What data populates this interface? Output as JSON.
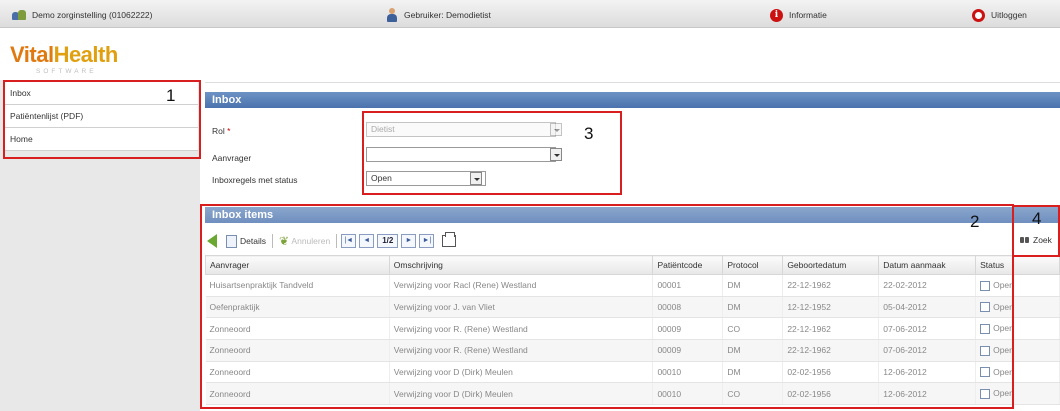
{
  "topbar": {
    "organization": "Demo zorginstelling (01062222)",
    "user": "Gebruiker: Demodietist",
    "info": "Informatie",
    "logout": "Uitloggen"
  },
  "logo": {
    "vital": "Vital",
    "health": "Health",
    "sub": "SOFTWARE"
  },
  "sidebar": {
    "items": [
      {
        "label": "Inbox"
      },
      {
        "label": "Patiëntenlijst (PDF)"
      },
      {
        "label": "Home"
      }
    ]
  },
  "inbox": {
    "title": "Inbox",
    "rol_label": "Rol",
    "rol_required": "*",
    "rol_value": "Dietist",
    "aanvrager_label": "Aanvrager",
    "aanvrager_value": "",
    "status_label": "Inboxregels met status",
    "status_value": "Open"
  },
  "items": {
    "title": "Inbox items",
    "toolbar": {
      "details": "Details",
      "annuleren": "Annuleren",
      "first": "|◄",
      "prev": "◄",
      "page": "1/2",
      "next": "►",
      "last": "►|"
    },
    "zoek": "Zoek",
    "columns": [
      "Aanvrager",
      "Omschrijving",
      "Patiëntcode",
      "Protocol",
      "Geboortedatum",
      "Datum aanmaak",
      "Status"
    ],
    "rows": [
      {
        "aanvrager": "Huisartsenpraktijk Tandveld",
        "omschrijving": "Verwijzing voor Racl (Rene) Westland",
        "code": "00001",
        "protocol": "DM",
        "geboortedatum": "22-12-1962",
        "aanmaak": "22-02-2012",
        "status": "Open"
      },
      {
        "aanvrager": "Oefenpraktijk",
        "omschrijving": "Verwijzing voor J. van Vliet",
        "code": "00008",
        "protocol": "DM",
        "geboortedatum": "12-12-1952",
        "aanmaak": "05-04-2012",
        "status": "Open"
      },
      {
        "aanvrager": "Zonneoord",
        "omschrijving": "Verwijzing voor R. (Rene) Westland",
        "code": "00009",
        "protocol": "CO",
        "geboortedatum": "22-12-1962",
        "aanmaak": "07-06-2012",
        "status": "Open"
      },
      {
        "aanvrager": "Zonneoord",
        "omschrijving": "Verwijzing voor R. (Rene) Westland",
        "code": "00009",
        "protocol": "DM",
        "geboortedatum": "22-12-1962",
        "aanmaak": "07-06-2012",
        "status": "Open"
      },
      {
        "aanvrager": "Zonneoord",
        "omschrijving": "Verwijzing voor D (Dirk) Meulen",
        "code": "00010",
        "protocol": "DM",
        "geboortedatum": "02-02-1956",
        "aanmaak": "12-06-2012",
        "status": "Open"
      },
      {
        "aanvrager": "Zonneoord",
        "omschrijving": "Verwijzing voor D (Dirk) Meulen",
        "code": "00010",
        "protocol": "CO",
        "geboortedatum": "02-02-1956",
        "aanmaak": "12-06-2012",
        "status": "Open"
      }
    ]
  },
  "annotations": [
    "1",
    "2",
    "3",
    "4"
  ],
  "colors": {
    "accent": "#4b72ad",
    "brand_orange": "#e07a10",
    "annotation_red": "#d81e1e"
  }
}
